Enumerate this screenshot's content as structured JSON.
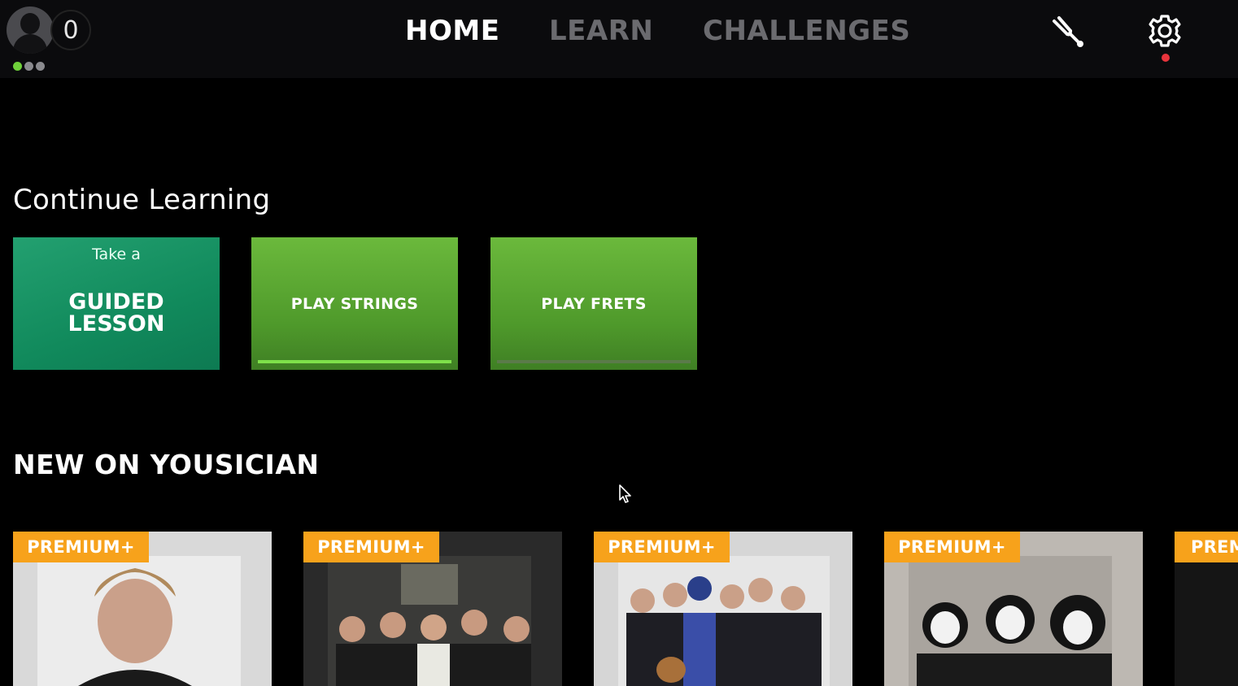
{
  "header": {
    "score": "0",
    "nav": [
      {
        "label": "HOME",
        "active": true
      },
      {
        "label": "LEARN",
        "active": false
      },
      {
        "label": "CHALLENGES",
        "active": false
      }
    ],
    "icons": [
      "profile-avatar",
      "tuning-fork-icon",
      "gear-icon"
    ],
    "notification_color": "#e8343c"
  },
  "continue_learning": {
    "title": "Continue Learning",
    "cards": [
      {
        "top_text": "Take a",
        "label": "GUIDED LESSON"
      },
      {
        "label": "PLAY STRINGS",
        "progress": 1.0
      },
      {
        "label": "PLAY FRETS",
        "progress": 0.0
      }
    ]
  },
  "new_section": {
    "title": "NEW ON YOUSICIAN",
    "items": [
      {
        "badge": "PREMIUM+"
      },
      {
        "badge": "PREMIUM+"
      },
      {
        "badge": "PREMIUM+"
      },
      {
        "badge": "PREMIUM+"
      },
      {
        "badge": "PREMIUM+"
      }
    ]
  },
  "colors": {
    "accent_green": "#6bb93c",
    "guided_teal": "#118a5c",
    "premium_orange": "#f7a21b"
  }
}
